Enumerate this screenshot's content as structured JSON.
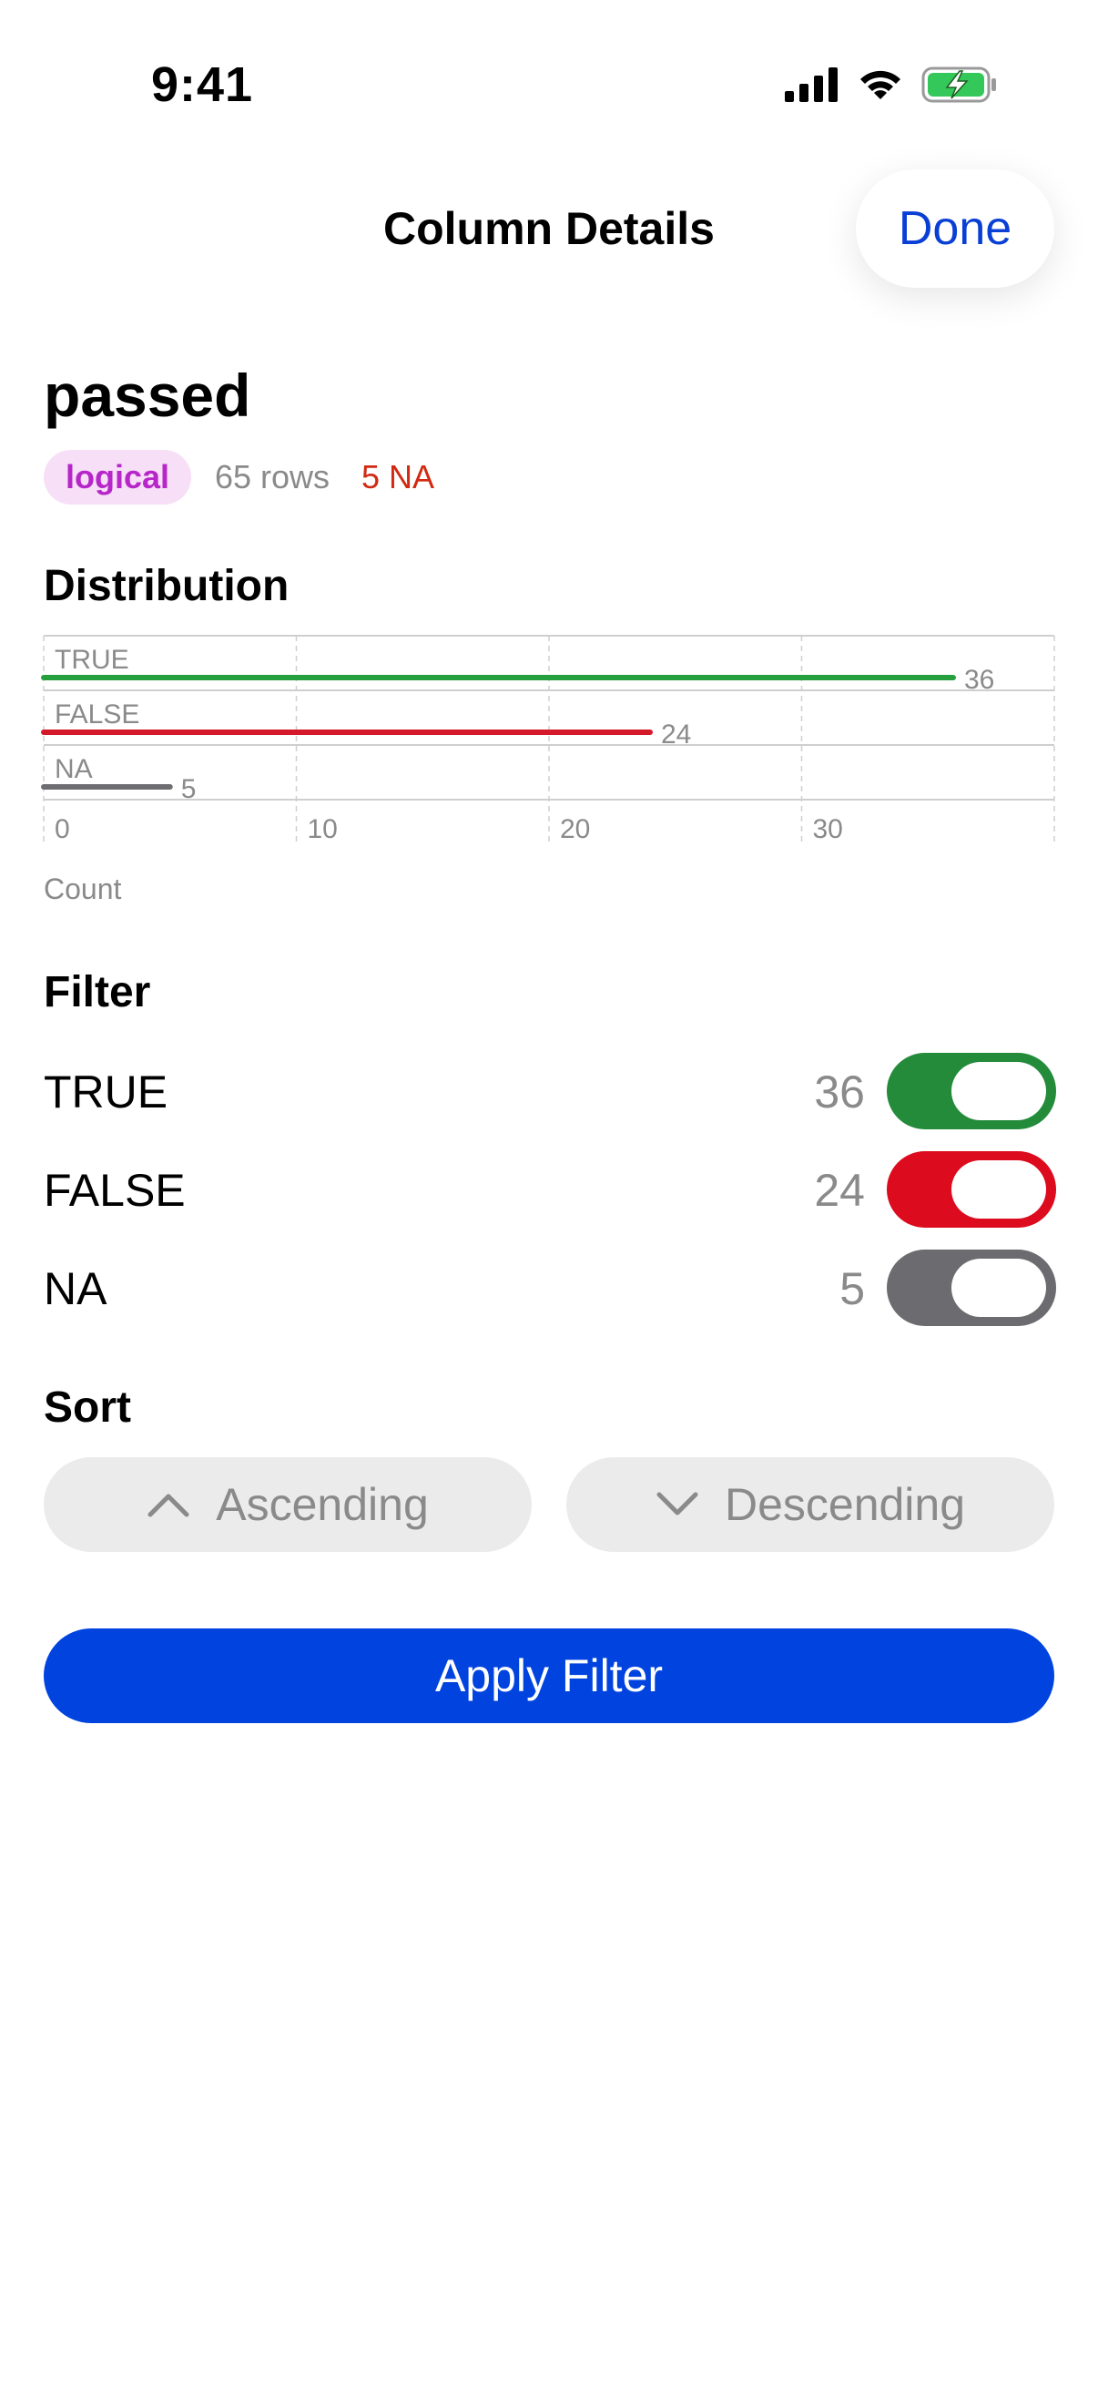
{
  "status_bar": {
    "time": "9:41"
  },
  "nav": {
    "title": "Column Details",
    "done_label": "Done"
  },
  "column": {
    "name": "passed",
    "type": "logical",
    "rows": "65 rows",
    "na": "5 NA"
  },
  "distribution": {
    "title": "Distribution",
    "axis_label": "Count"
  },
  "chart_data": {
    "type": "bar",
    "orientation": "horizontal",
    "categories": [
      "TRUE",
      "FALSE",
      "NA"
    ],
    "values": [
      36,
      24,
      5
    ],
    "colors": [
      "#26a03e",
      "#d41a2a",
      "#6e6e72"
    ],
    "xlabel": "Count",
    "xlim": [
      0,
      40
    ],
    "xticks": [
      0,
      10,
      20,
      30
    ],
    "grid": true
  },
  "filter": {
    "title": "Filter",
    "items": [
      {
        "label": "TRUE",
        "count": "36",
        "color": "#238b3a"
      },
      {
        "label": "FALSE",
        "count": "24",
        "color": "#dc0c1e"
      },
      {
        "label": "NA",
        "count": "5",
        "color": "#6b6b70"
      }
    ]
  },
  "sort": {
    "title": "Sort",
    "ascending": "Ascending",
    "descending": "Descending"
  },
  "apply_label": "Apply Filter"
}
